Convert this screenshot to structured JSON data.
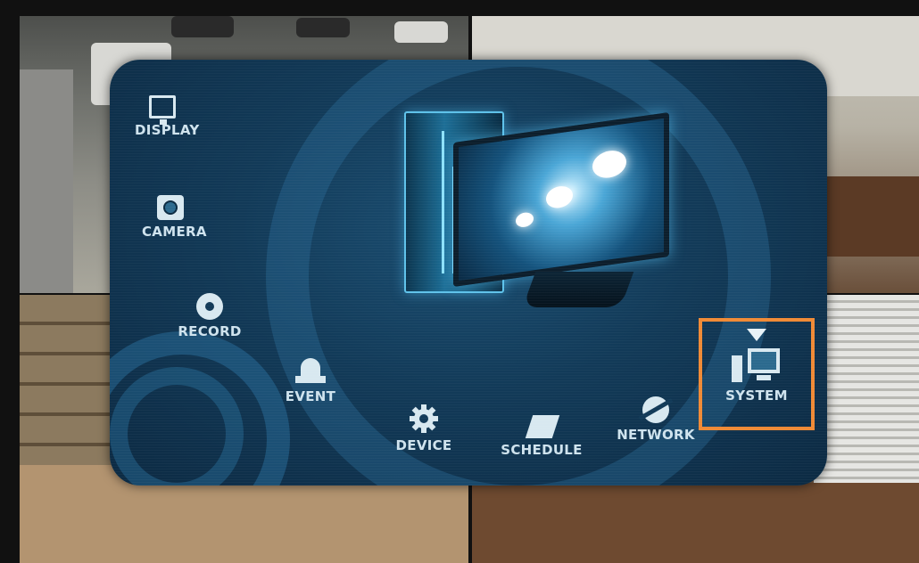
{
  "menu": {
    "items": [
      {
        "key": "display",
        "label": "DISPLAY",
        "icon": "display-icon"
      },
      {
        "key": "camera",
        "label": "CAMERA",
        "icon": "camera-icon"
      },
      {
        "key": "record",
        "label": "RECORD",
        "icon": "record-icon"
      },
      {
        "key": "event",
        "label": "EVENT",
        "icon": "event-icon"
      },
      {
        "key": "device",
        "label": "DEVICE",
        "icon": "gear-icon"
      },
      {
        "key": "schedule",
        "label": "SCHEDULE",
        "icon": "schedule-icon"
      },
      {
        "key": "network",
        "label": "NETWORK",
        "icon": "network-icon"
      },
      {
        "key": "system",
        "label": "SYSTEM",
        "icon": "system-icon",
        "selected": true
      }
    ],
    "selected": "system",
    "highlight_color": "#f08a36"
  },
  "colors": {
    "panel": "#123a58",
    "label": "#cfe3ee",
    "accent": "#f08a36"
  }
}
